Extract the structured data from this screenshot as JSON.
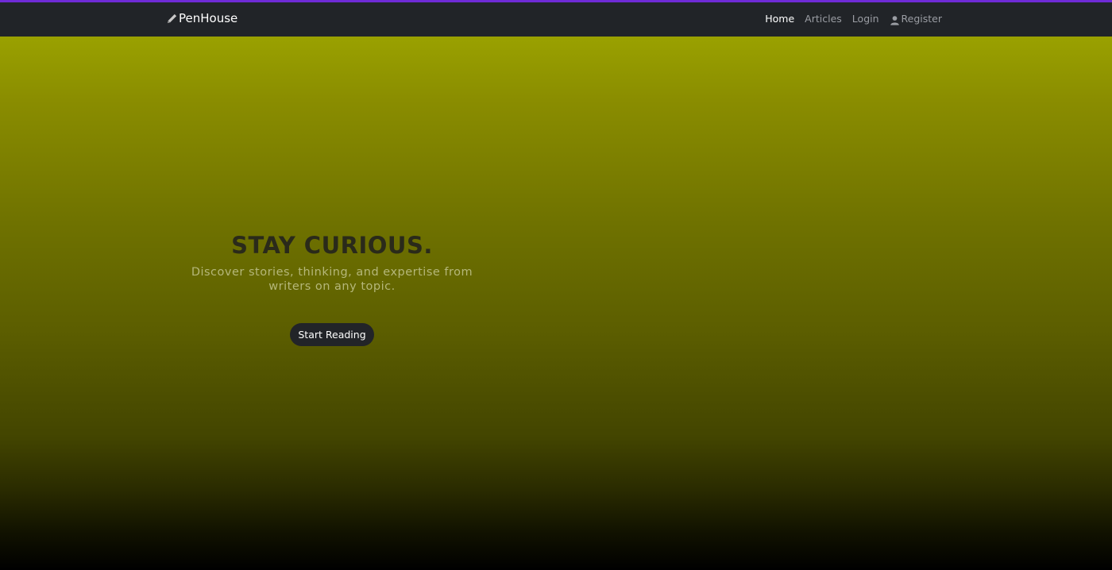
{
  "colors": {
    "accent": "#6f2bd6",
    "navbar_bg": "#212428",
    "hero_gradient_top": "#9aa100",
    "hero_gradient_bottom": "#000000",
    "button_bg": "#222428"
  },
  "navbar": {
    "brand": {
      "icon": "pencil-icon",
      "label": "PenHouse"
    },
    "links": [
      {
        "label": "Home",
        "active": true
      },
      {
        "label": "Articles",
        "active": false
      },
      {
        "label": "Login",
        "active": false
      },
      {
        "label": "Register",
        "active": false,
        "icon": "user-icon"
      }
    ]
  },
  "hero": {
    "title": "STAY CURIOUS.",
    "subtitle": "Discover stories, thinking, and expertise from writers on any topic.",
    "cta_label": "Start Reading"
  }
}
